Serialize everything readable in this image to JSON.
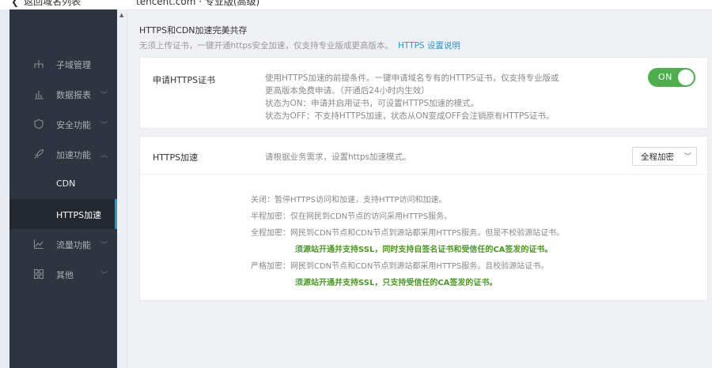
{
  "topbar": {
    "back_label": "返回域名列表",
    "domain": "tencent.com · 专业版(高级)"
  },
  "sidebar": {
    "items": [
      {
        "label": "子域管理"
      },
      {
        "label": "数据报表",
        "chevron": "﹀"
      },
      {
        "label": "安全功能",
        "chevron": "﹀"
      },
      {
        "label": "加速功能",
        "chevron": "︿"
      },
      {
        "label": "CDN"
      },
      {
        "label": "HTTPS加速"
      },
      {
        "label": "流量功能",
        "chevron": "﹀"
      },
      {
        "label": "其他",
        "chevron": "﹀"
      }
    ]
  },
  "section": {
    "title": "HTTPS和CDN加速完美共存",
    "desc": "无须上传证书，一键开通https安全加速，仅支持专业版或更高版本。",
    "link": "HTTPS 设置说明"
  },
  "cert": {
    "label": "申请HTTPS证书",
    "desc": [
      "使用HTTPS加速的前提条件。一键申请域名专有的HTTPS证书，仅支持专业版或",
      "更高版本免费申请。（开通后24小时内生效）",
      "状态为ON：申请并启用证书，可设置HTTPS加速的模式。",
      "状态为OFF：不支持HTTPS加速，状态从ON变成OFF会注销原有HTTPS证书。"
    ],
    "toggle_label": "ON",
    "toggle_color": "#4cae4c"
  },
  "accel": {
    "label": "HTTPS加速",
    "desc": "请根据业务需求，设置https加速模式。",
    "select_value": "全程加密",
    "modes": [
      "关闭：暂停HTTPS访问和加速，支持HTTP访问和加速。",
      "半程加密：仅在网民到CDN节点的访问采用HTTPS服务。",
      "全程加密：网民到CDN节点和CDN节点到源站都采用HTTPS服务。但是不校验源站证书。",
      "须源站开通并支持SSL，同时支持自签名证书和受信任的CA签发的证书。",
      "严格加密：网民到CDN节点和CDN节点到源站都采用HTTPS服务。且校验源站证书。",
      "须源站开通并支持SSL，只支持受信任的CA签发的证书。"
    ]
  }
}
